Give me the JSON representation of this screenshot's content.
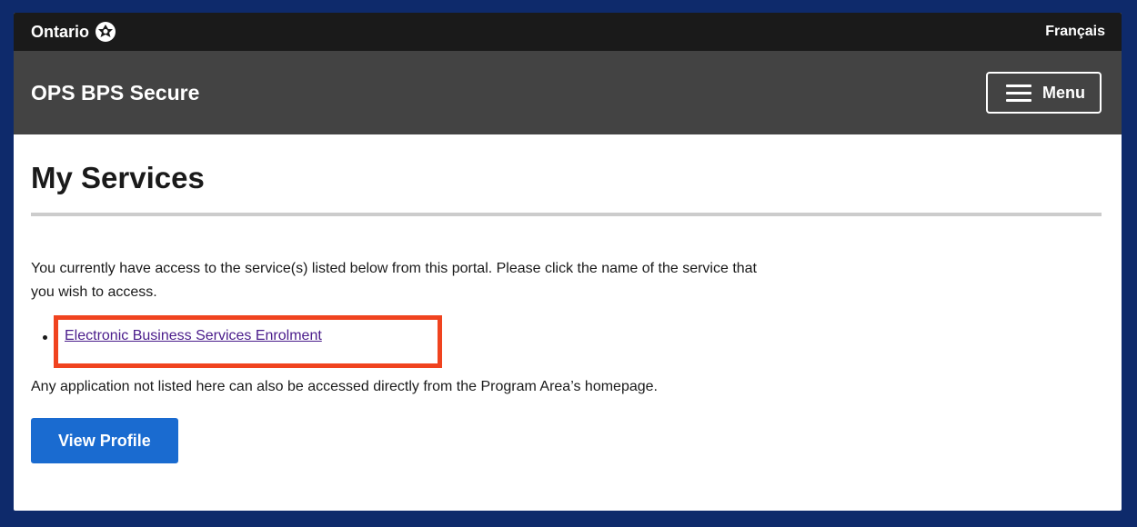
{
  "topbar": {
    "brand": "Ontario",
    "language_link": "Français"
  },
  "header": {
    "app_title": "OPS BPS Secure",
    "menu_label": "Menu"
  },
  "main": {
    "page_title": "My Services",
    "intro": "You currently have access to the service(s) listed below from this portal. Please click the name of the service that you wish to access.",
    "services": [
      {
        "label": "Electronic Business Services Enrolment"
      }
    ],
    "note": "Any application not listed here can also be accessed directly from the Program Area’s homepage.",
    "view_profile_label": "View Profile"
  },
  "colors": {
    "topbar_bg": "#1a1a1a",
    "header_bg": "#434343",
    "primary_button": "#1a6bd0",
    "link": "#4a1c8b",
    "highlight_border": "#f0431f",
    "outer_frame": "#0e2a6b"
  },
  "icons": {
    "brand_logo": "ontario-trillium-icon",
    "menu": "hamburger-icon"
  }
}
